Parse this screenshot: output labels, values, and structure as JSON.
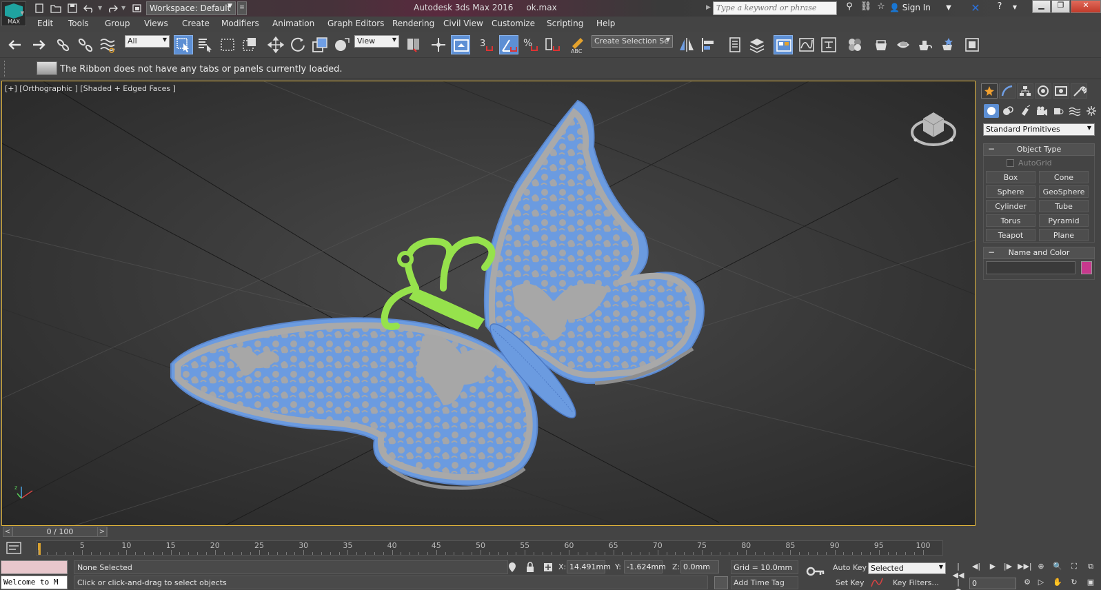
{
  "app": {
    "logo_text": "MAX",
    "title": "Autodesk 3ds Max 2016",
    "filename": "ok.max",
    "workspace_label": "Workspace: Default",
    "search_placeholder": "Type a keyword or phrase",
    "sign_in": "Sign In"
  },
  "menu": [
    "Edit",
    "Tools",
    "Group",
    "Views",
    "Create",
    "Modifiers",
    "Animation",
    "Graph Editors",
    "Rendering",
    "Civil View",
    "Customize",
    "Scripting",
    "Help"
  ],
  "toolbar": {
    "selection_filter": "All",
    "ref_coord": "View",
    "named_selection": "Create Selection Se",
    "snap_label": "3"
  },
  "ribbon": {
    "message": "The Ribbon does not have any tabs or panels currently loaded."
  },
  "viewport": {
    "label": "[+] [Orthographic ] [Shaded + Edged Faces ]",
    "border_color": "#e0b43a",
    "wing_color": "#a6a6a6",
    "wing_edge_color": "#6b9be0",
    "body_color": "#6b9be0",
    "antenna_color": "#96e24c"
  },
  "command_panel": {
    "category": "Standard Primitives",
    "object_type_title": "Object Type",
    "autogrid_label": "AutoGrid",
    "primitives": [
      "Box",
      "Cone",
      "Sphere",
      "GeoSphere",
      "Cylinder",
      "Tube",
      "Torus",
      "Pyramid",
      "Teapot",
      "Plane"
    ],
    "name_color_title": "Name and Color",
    "object_color": "#c7388d"
  },
  "timeline": {
    "frame_display": "0 / 100",
    "ticks": [
      "5",
      "10",
      "15",
      "20",
      "25",
      "30",
      "35",
      "40",
      "45",
      "50",
      "55",
      "60",
      "65",
      "70",
      "75",
      "80",
      "85",
      "90",
      "95",
      "100"
    ]
  },
  "status": {
    "maxscript_text": "Welcome to M",
    "selection": "None Selected",
    "prompt": "Click or click-and-drag to select objects",
    "x_label": "X:",
    "x_value": "14.491mm",
    "y_label": "Y:",
    "y_value": "-1.624mm",
    "z_label": "Z:",
    "z_value": "0.0mm",
    "grid": "Grid = 10.0mm",
    "add_time_tag": "Add Time Tag",
    "auto_key": "Auto Key",
    "set_key": "Set Key",
    "key_mode": "Selected",
    "key_filters": "Key Filters...",
    "current_frame": "0"
  }
}
